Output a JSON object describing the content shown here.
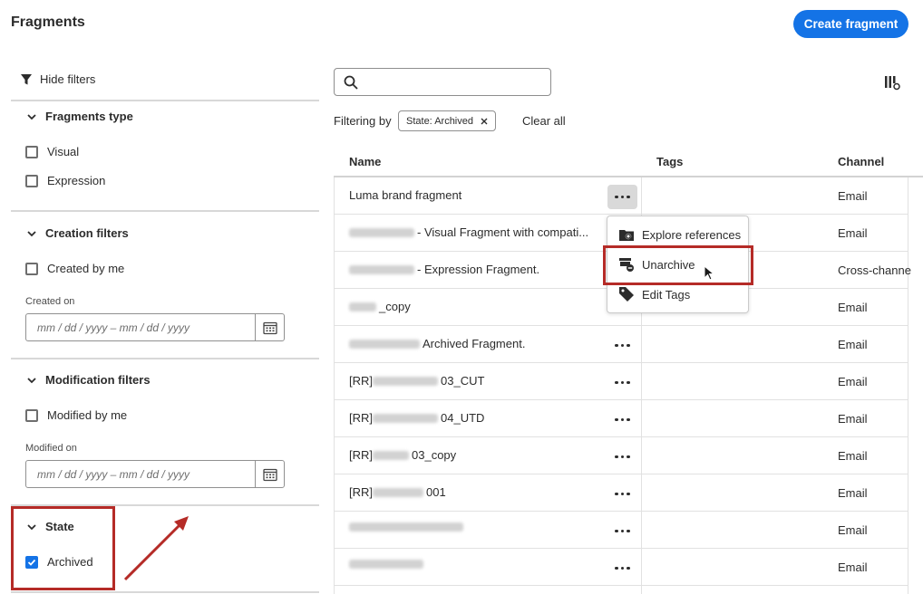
{
  "page": {
    "title": "Fragments",
    "create_button": "Create fragment"
  },
  "filters": {
    "hide_label": "Hide filters",
    "fragments_type": {
      "title": "Fragments type",
      "options": [
        "Visual",
        "Expression"
      ]
    },
    "creation": {
      "title": "Creation filters",
      "created_by_me": "Created by me",
      "date_label": "Created on",
      "date_placeholder": "mm / dd / yyyy  –  mm / dd / yyyy"
    },
    "modification": {
      "title": "Modification filters",
      "modified_by_me": "Modified by me",
      "date_label": "Modified on",
      "date_placeholder": "mm / dd / yyyy  –  mm / dd / yyyy"
    },
    "state": {
      "title": "State",
      "archived": "Archived",
      "archived_checked": true
    }
  },
  "toolbar": {
    "filtering_by": "Filtering by",
    "active_filter": "State: Archived",
    "clear_all": "Clear all"
  },
  "table": {
    "headers": {
      "name": "Name",
      "tags": "Tags",
      "channel": "Channel"
    },
    "rows": [
      {
        "name": "Luma brand fragment",
        "channel": "Email"
      },
      {
        "name": "- Visual Fragment with compati...",
        "channel": "Email"
      },
      {
        "name": "- Expression Fragment.",
        "channel": "Cross-channe"
      },
      {
        "name": "_copy",
        "channel": "Email"
      },
      {
        "name": "Archived Fragment.",
        "channel": "Email"
      },
      {
        "name_prefix": "[RR]",
        "name": "03_CUT",
        "channel": "Email"
      },
      {
        "name_prefix": "[RR]",
        "name": "04_UTD",
        "channel": "Email"
      },
      {
        "name_prefix": "[RR]",
        "name": "03_copy",
        "channel": "Email"
      },
      {
        "name_prefix": "[RR]",
        "name": "001",
        "channel": "Email"
      },
      {
        "name": "",
        "channel": "Email"
      },
      {
        "name": "",
        "channel": "Email"
      }
    ]
  },
  "context_menu": {
    "items": [
      "Explore references",
      "Unarchive",
      "Edit Tags"
    ]
  },
  "colors": {
    "accent": "#1473e6",
    "highlight": "#b52b27"
  }
}
